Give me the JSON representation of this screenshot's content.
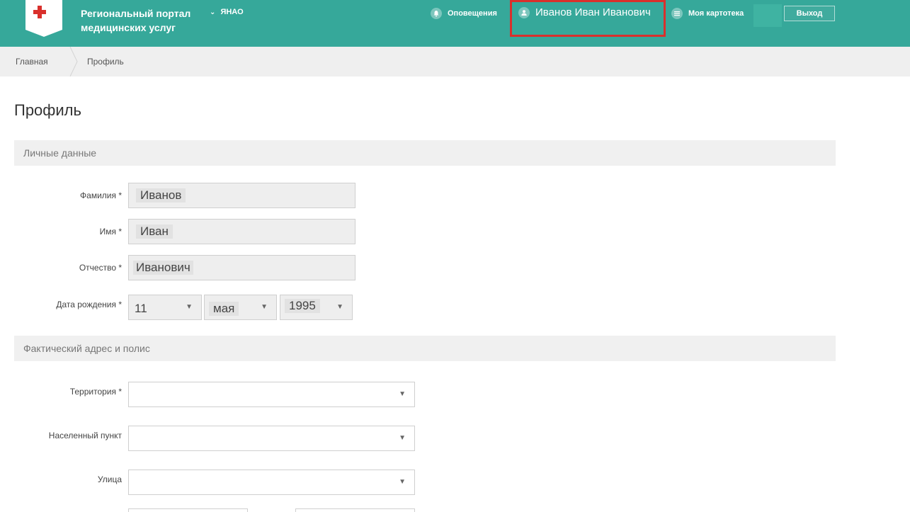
{
  "header": {
    "brand_line1": "Региональный портал",
    "brand_line2": "медицинских услуг",
    "region": "ЯНАО",
    "notifications_label": "Оповещения",
    "user_name": "Иванов Иван Иванович",
    "cards_label": "Моя картотека",
    "exit_label": "Выход",
    "colors": {
      "header_bg": "#36a89a",
      "highlight_border": "#d9302c"
    }
  },
  "breadcrumb": {
    "home": "Главная",
    "current": "Профиль"
  },
  "page": {
    "title": "Профиль"
  },
  "personal": {
    "section_title": "Личные данные",
    "surname_label": "Фамилия *",
    "surname_value": "Иванов",
    "name_label": "Имя *",
    "name_value": "Иван",
    "patronymic_label": "Отчество *",
    "patronymic_value": "Иванович",
    "birthdate_label": "Дата рождения *",
    "birth_day": "11",
    "birth_month": "мая",
    "birth_year": "1995"
  },
  "address": {
    "section_title": "Фактический адрес и полис",
    "territory_label": "Территория *",
    "locality_label": "Населенный пункт",
    "street_label": "Улица"
  }
}
